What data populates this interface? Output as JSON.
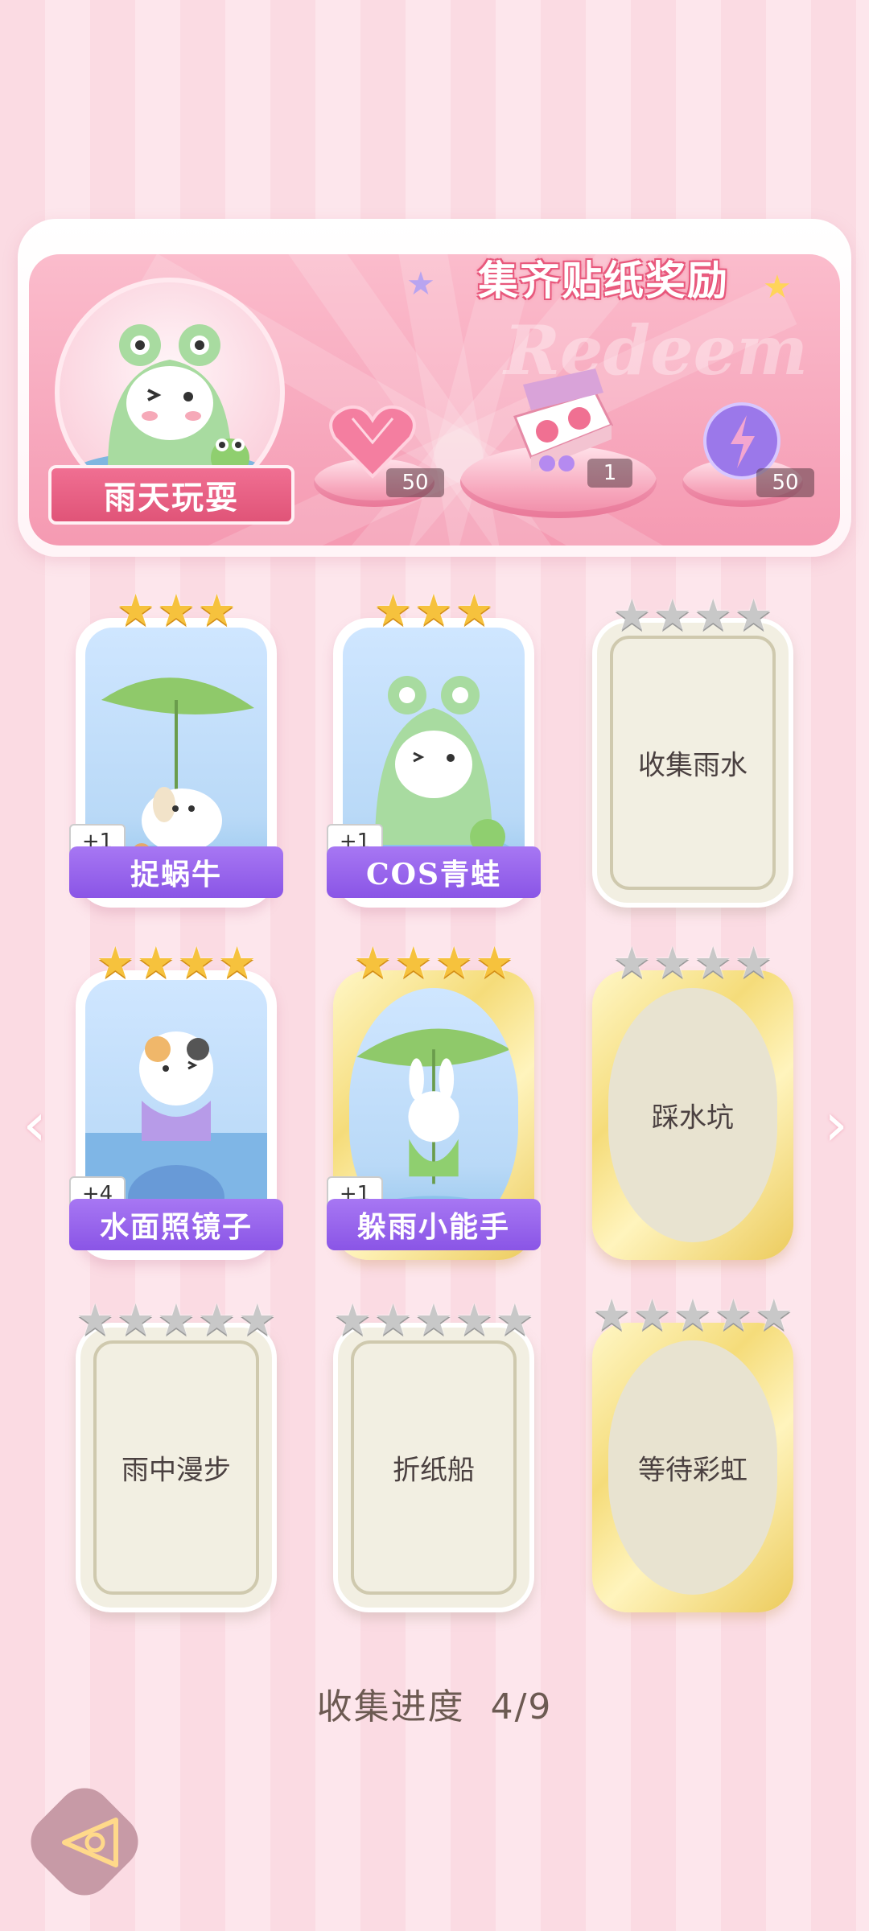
{
  "banner": {
    "title": "集齐贴纸奖励",
    "watermark": "Redeem",
    "character_name": "雨天玩耍",
    "rewards": [
      {
        "icon": "pink-heart-gem-icon",
        "count": "50"
      },
      {
        "icon": "gift-box-icon",
        "count": "1"
      },
      {
        "icon": "purple-energy-orb-icon",
        "count": "50"
      }
    ]
  },
  "cards": [
    {
      "label": "捉蜗牛",
      "stars_total": 3,
      "stars_filled": 3,
      "plus": "+1",
      "state": "collected"
    },
    {
      "label": "COS青蛙",
      "stars_total": 3,
      "stars_filled": 3,
      "plus": "+1",
      "state": "collected"
    },
    {
      "label": "收集雨水",
      "stars_total": 4,
      "stars_filled": 0,
      "state": "locked"
    },
    {
      "label": "水面照镜子",
      "stars_total": 4,
      "stars_filled": 4,
      "plus": "+4",
      "state": "collected"
    },
    {
      "label": "躲雨小能手",
      "stars_total": 4,
      "stars_filled": 4,
      "plus": "+1",
      "state": "collected-gold"
    },
    {
      "label": "踩水坑",
      "stars_total": 4,
      "stars_filled": 0,
      "state": "locked-gold"
    },
    {
      "label": "雨中漫步",
      "stars_total": 5,
      "stars_filled": 0,
      "state": "locked"
    },
    {
      "label": "折纸船",
      "stars_total": 5,
      "stars_filled": 0,
      "state": "locked"
    },
    {
      "label": "等待彩虹",
      "stars_total": 5,
      "stars_filled": 0,
      "state": "locked-gold"
    }
  ],
  "progress": {
    "label": "收集进度",
    "value": "4/9"
  },
  "colors": {
    "pink_bg": "#fbdbe3",
    "label_purple": "#8a55e6",
    "star_gold": "#f6c23d",
    "star_grey": "#c8c8c8"
  }
}
